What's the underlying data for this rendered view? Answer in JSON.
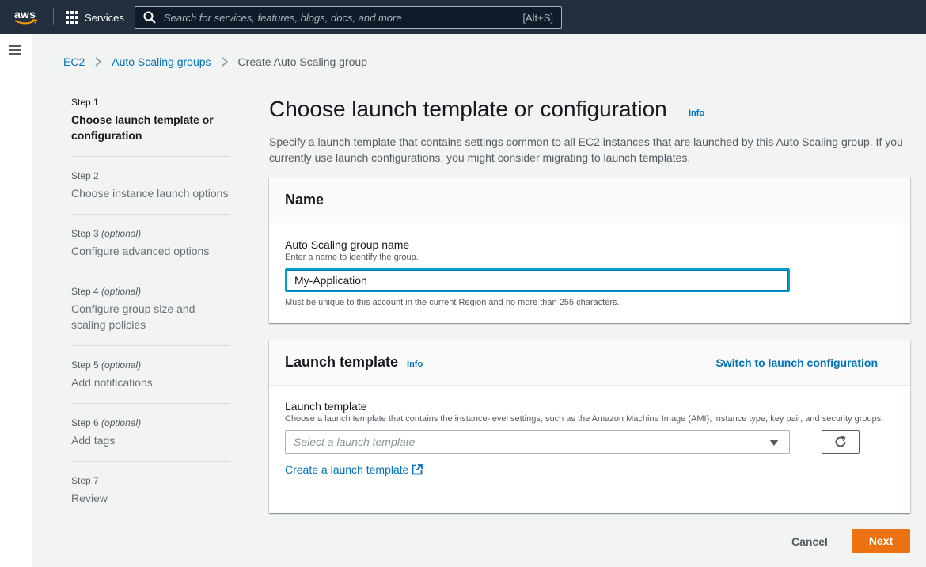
{
  "header": {
    "logo_text": "aws",
    "services_label": "Services",
    "search_placeholder": "Search for services, features, blogs, docs, and more",
    "search_shortcut": "[Alt+S]"
  },
  "breadcrumb": {
    "items": [
      "EC2",
      "Auto Scaling groups"
    ],
    "current": "Create Auto Scaling group"
  },
  "steps": [
    {
      "num": "Step 1",
      "optional": "",
      "title": "Choose launch template or configuration",
      "active": true
    },
    {
      "num": "Step 2",
      "optional": "",
      "title": "Choose instance launch options",
      "active": false
    },
    {
      "num": "Step 3",
      "optional": "(optional)",
      "title": "Configure advanced options",
      "active": false
    },
    {
      "num": "Step 4",
      "optional": "(optional)",
      "title": "Configure group size and scaling policies",
      "active": false
    },
    {
      "num": "Step 5",
      "optional": "(optional)",
      "title": "Add notifications",
      "active": false
    },
    {
      "num": "Step 6",
      "optional": "(optional)",
      "title": "Add tags",
      "active": false
    },
    {
      "num": "Step 7",
      "optional": "",
      "title": "Review",
      "active": false
    }
  ],
  "main": {
    "title": "Choose launch template or configuration",
    "info": "Info",
    "description": "Specify a launch template that contains settings common to all EC2 instances that are launched by this Auto Scaling group. If you currently use launch configurations, you might consider migrating to launch templates."
  },
  "name_panel": {
    "title": "Name",
    "label": "Auto Scaling group name",
    "sublabel": "Enter a name to identify the group.",
    "value": "My-Application",
    "constraint": "Must be unique to this account in the current Region and no more than 255 characters."
  },
  "template_panel": {
    "title": "Launch template",
    "info": "Info",
    "switch_link": "Switch to launch configuration",
    "label": "Launch template",
    "sublabel": "Choose a launch template that contains the instance-level settings, such as the Amazon Machine Image (AMI), instance type, key pair, and security groups.",
    "select_placeholder": "Select a launch template",
    "create_link": "Create a launch template"
  },
  "footer": {
    "cancel": "Cancel",
    "next": "Next"
  },
  "colors": {
    "header_bg": "#232f3e",
    "link": "#0073bb",
    "primary_button": "#ec7211",
    "smile": "#ff9900"
  }
}
